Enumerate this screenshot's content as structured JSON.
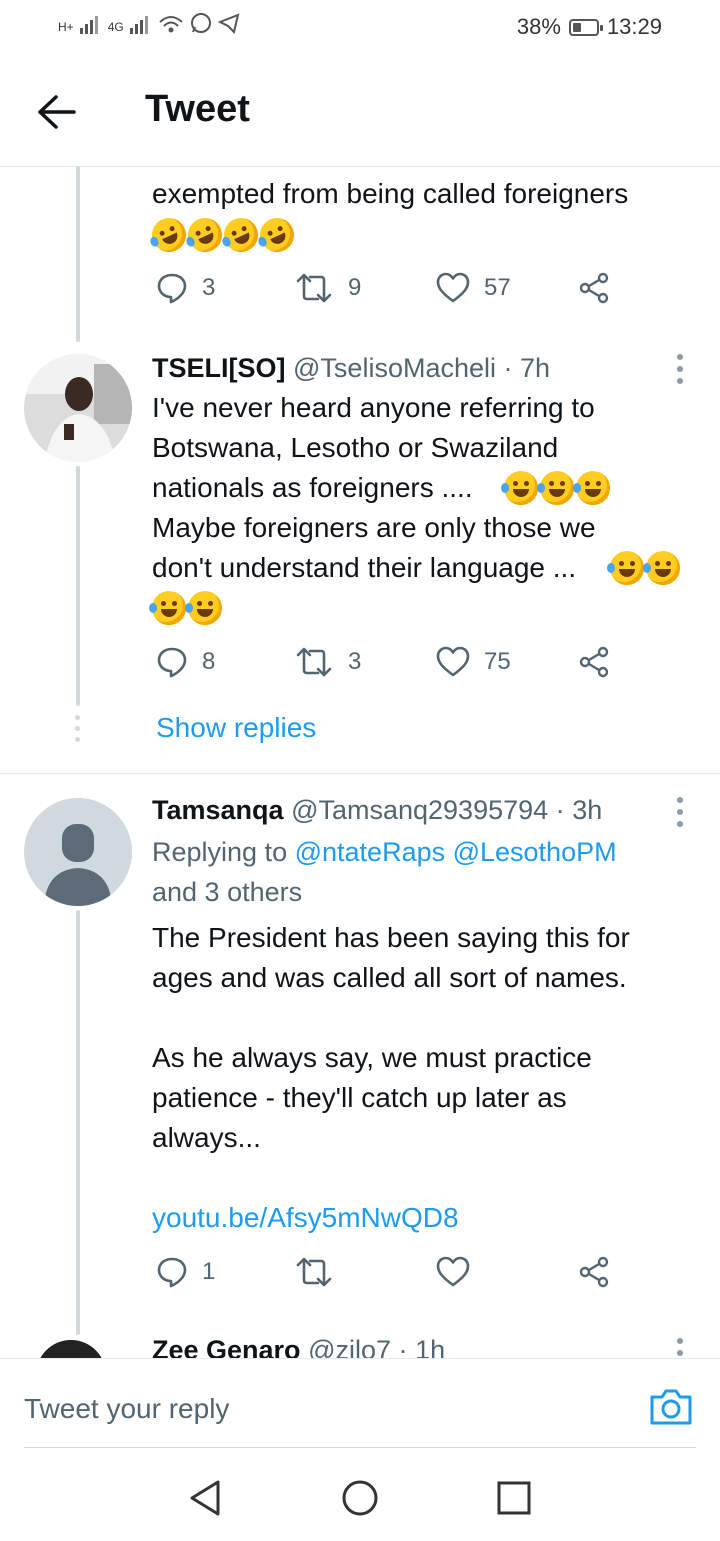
{
  "status_bar": {
    "network1": "H+",
    "network2": "4G",
    "battery": "38%",
    "battery_level": 0.38,
    "time": "13:29"
  },
  "header": {
    "title": "Tweet"
  },
  "tweets": [
    {
      "text_partial": "exempted from being called foreigners",
      "emoji_row": [
        "rofl",
        "rofl",
        "rofl",
        "rofl"
      ],
      "reply_count": "3",
      "retweet_count": "9",
      "like_count": "57"
    },
    {
      "name": "TSELI[SO]",
      "handle": "@TselisoMacheli",
      "time": "7h",
      "lines": [
        "I've never heard anyone referring to",
        "Botswana, Lesotho or Swaziland",
        "nationals as foreigners ....",
        "Maybe foreigners are only those we",
        "don't understand their language ..."
      ],
      "reply_count": "8",
      "retweet_count": "3",
      "like_count": "75",
      "show_replies": "Show replies"
    },
    {
      "name": "Tamsanqa",
      "handle": "@Tamsanq29395794",
      "time": "3h",
      "replying_prefix": "Replying to",
      "replying_users": "@ntateRaps @LesothoPM",
      "replying_others": "and 3 others",
      "lines": [
        "The President has been saying this for",
        "ages and was called all sort of names.",
        "As he always say, we must practice",
        "patience - they'll catch up later as",
        "always..."
      ],
      "link": "youtu.be/Afsy5mNwQD8",
      "reply_count": "1"
    },
    {
      "name": "Zee Genaro",
      "handle": "@zilo7",
      "time": "1h"
    }
  ],
  "compose": {
    "placeholder": "Tweet your reply"
  },
  "colors": {
    "accent": "#1d9bf0",
    "text": "#0f1419",
    "muted": "#536471",
    "thread": "#cfd9de"
  },
  "icons": [
    "back-arrow-icon",
    "reply-icon",
    "retweet-icon",
    "like-icon",
    "share-icon",
    "more-icon",
    "camera-icon",
    "nav-back-icon",
    "nav-home-icon",
    "nav-recents-icon"
  ]
}
